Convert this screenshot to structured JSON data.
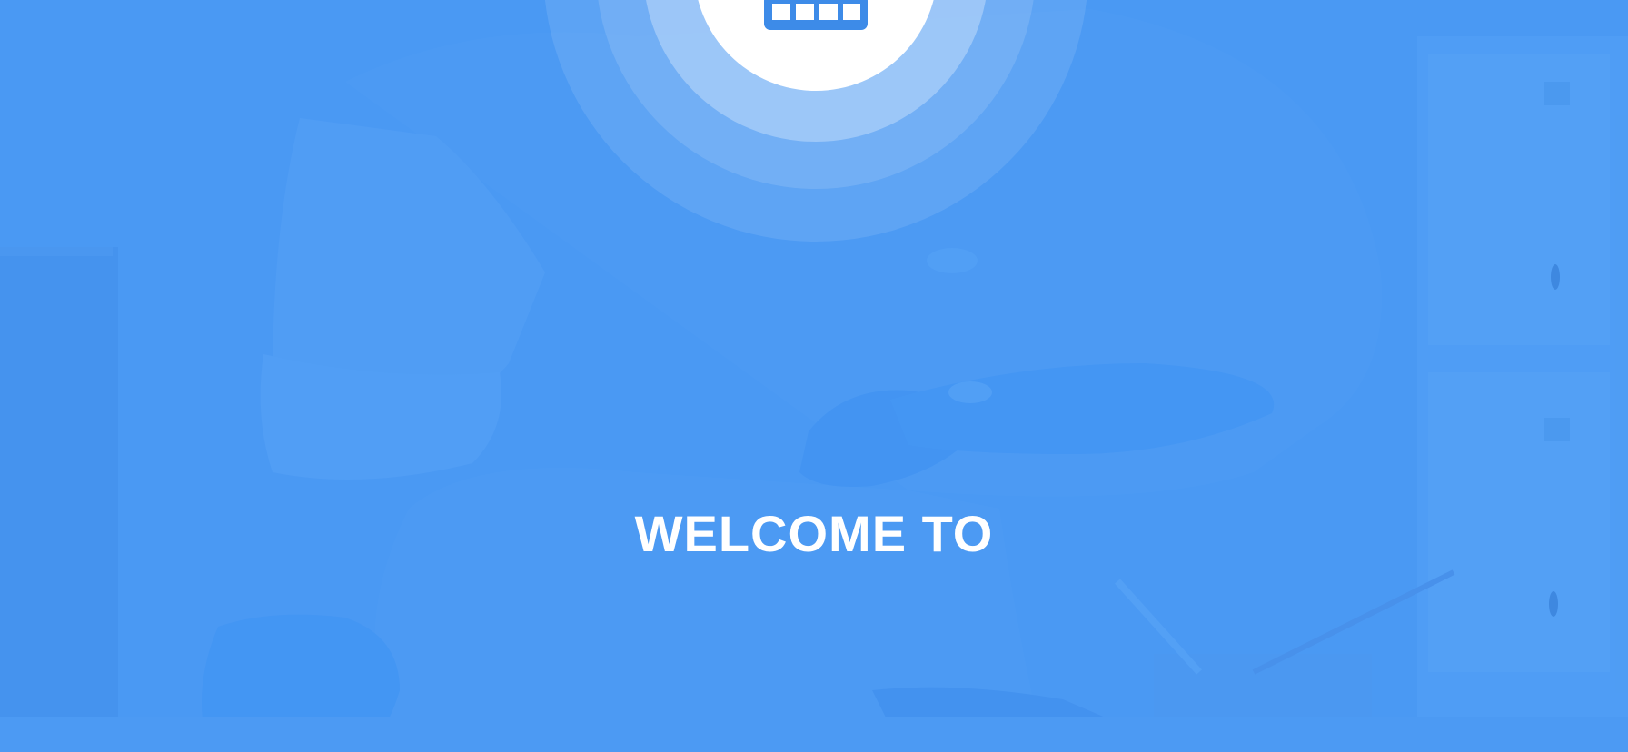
{
  "screen": {
    "welcome_text": "WELCOME TO",
    "logo_icon": "calendar-icon",
    "colors": {
      "background": "#4b99f2",
      "ring_outer": "#6aaaf5",
      "ring_middle": "#8bbdf7",
      "ring_inner": "#b3d3fa",
      "logo_disc": "#ffffff",
      "icon": "#3d8be8",
      "text": "#ffffff"
    }
  }
}
